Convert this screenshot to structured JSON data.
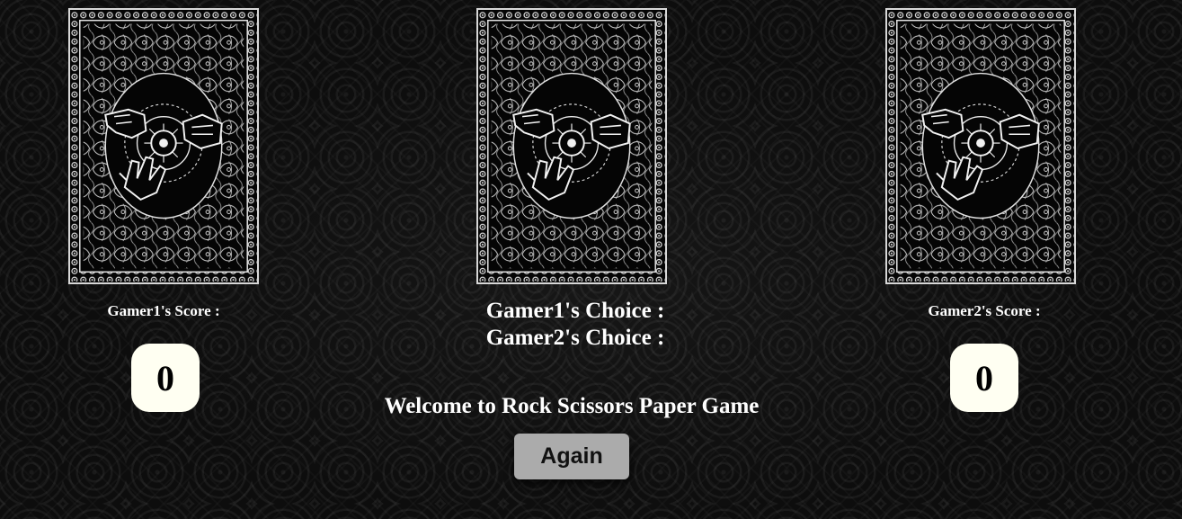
{
  "cards": [
    {
      "id": "left",
      "image": "card-back-icon"
    },
    {
      "id": "center",
      "image": "card-back-icon"
    },
    {
      "id": "right",
      "image": "card-back-icon"
    }
  ],
  "gamer1": {
    "score_label": "Gamer1's Score :",
    "score": "0"
  },
  "gamer2": {
    "score_label": "Gamer2's Score :",
    "score": "0"
  },
  "choices": {
    "gamer1_label": "Gamer1's Choice :",
    "gamer2_label": "Gamer2's Choice :"
  },
  "message": "Welcome to Rock Scissors Paper Game",
  "again_button": "Again",
  "colors": {
    "background": "#0d0d0d",
    "text": "#ffffff",
    "score_box": "#fffff2",
    "button": "#ababab"
  }
}
